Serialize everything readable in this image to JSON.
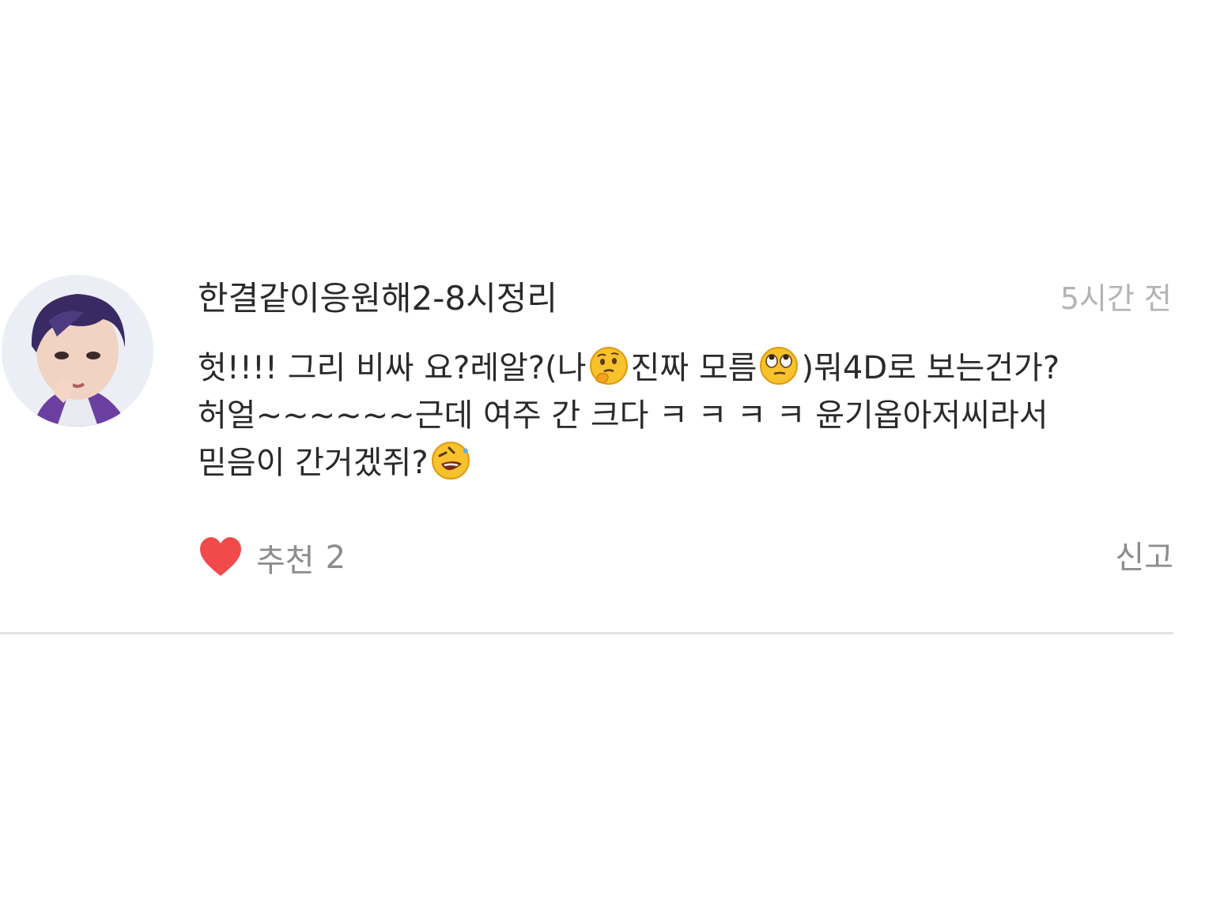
{
  "comment": {
    "username": "한결같이응원해2-8시정리",
    "timestamp": "5시간 전",
    "body_lines": [
      [
        "헛!!!! 그리 비싸 요?레알?(나",
        "진짜 모름",
        ")뭐4D로 보는건가?"
      ],
      [
        "허얼~~~~~~근데 여주 간 크다 ㅋ ㅋ ㅋ ㅋ 윤기옵아저씨라서"
      ],
      [
        "믿음이 간거겠쥐?"
      ]
    ],
    "emojis": [
      "thinking-face-emoji",
      "rolling-eyes-face-emoji",
      "rolling-on-floor-laughing-emoji"
    ],
    "like": {
      "icon": "heart-icon",
      "label": "추천",
      "count": "2",
      "color": "#f04a4a"
    },
    "report_label": "신고"
  }
}
